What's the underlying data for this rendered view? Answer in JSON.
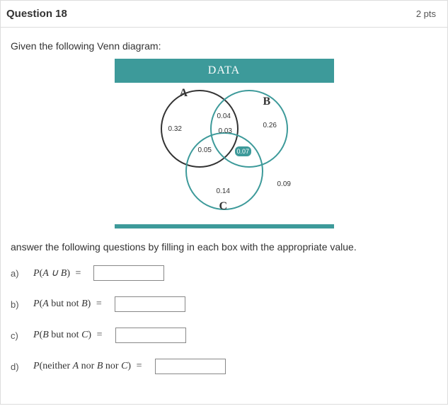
{
  "header": {
    "title": "Question 18",
    "points": "2 pts"
  },
  "intro": "Given the following Venn diagram:",
  "venn": {
    "title": "DATA",
    "labelA": "A",
    "labelB": "B",
    "labelC": "C",
    "regions": {
      "A_only": "0.32",
      "B_only": "0.26",
      "C_only": "0.14",
      "AB": "0.04",
      "ABC": "0.03",
      "AC": "0.05",
      "BC": "0.07",
      "outside": "0.09"
    }
  },
  "instruction": "answer the following questions by filling in each box with the appropriate value.",
  "parts": {
    "a": {
      "letter": "a)",
      "expr_pre": "P",
      "expr_inner": "A ∪ B",
      "eq": "="
    },
    "b": {
      "letter": "b)",
      "expr_pre": "P",
      "expr_inner_italic1": "A",
      "expr_inner_rm": " but not ",
      "expr_inner_italic2": "B",
      "eq": "="
    },
    "c": {
      "letter": "c)",
      "expr_pre": "P",
      "expr_inner_italic1": "B",
      "expr_inner_rm": " but not ",
      "expr_inner_italic2": "C",
      "eq": "="
    },
    "d": {
      "letter": "d)",
      "expr_pre": "P",
      "expr_inner_rm1": "neither ",
      "expr_inner_i1": "A",
      "expr_inner_rm2": " nor ",
      "expr_inner_i2": "B",
      "expr_inner_rm3": " nor ",
      "expr_inner_i3": "C",
      "eq": "="
    }
  }
}
